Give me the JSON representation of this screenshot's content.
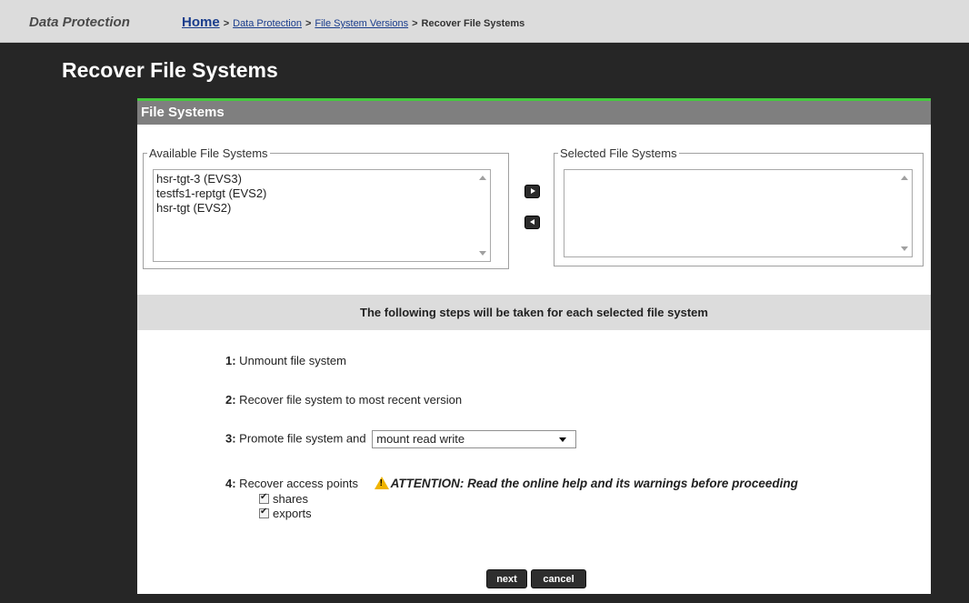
{
  "header": {
    "section": "Data Protection",
    "breadcrumb": [
      {
        "label": "Home"
      },
      {
        "label": "Data Protection"
      },
      {
        "label": "File System Versions"
      },
      {
        "label": "Recover File Systems"
      }
    ],
    "separator": ">"
  },
  "page_title": "Recover File Systems",
  "panel": {
    "title": "File Systems",
    "available": {
      "legend": "Available File Systems",
      "items": [
        "hsr-tgt-3 (EVS3)",
        "testfs1-reptgt (EVS2)",
        "hsr-tgt (EVS2)"
      ]
    },
    "selected": {
      "legend": "Selected File Systems",
      "items": []
    }
  },
  "steps": {
    "heading": "The following steps will be taken for each selected file system",
    "step1": {
      "num": "1:",
      "text": " Unmount file system"
    },
    "step2": {
      "num": "2:",
      "text": " Recover file system to most recent version"
    },
    "step3": {
      "num": "3:",
      "text": " Promote file system and",
      "select_value": "mount read write"
    },
    "step4": {
      "num": "4:",
      "text": " Recover access points",
      "warning": "ATTENTION: Read the online help and its warnings before proceeding"
    },
    "options": [
      {
        "label": "shares",
        "checked": true
      },
      {
        "label": "exports",
        "checked": true
      }
    ]
  },
  "buttons": {
    "next": "next",
    "cancel": "cancel"
  },
  "colors": {
    "accent": "#45c73e",
    "background": "#262626",
    "panel_header": "#7f7f7f"
  }
}
